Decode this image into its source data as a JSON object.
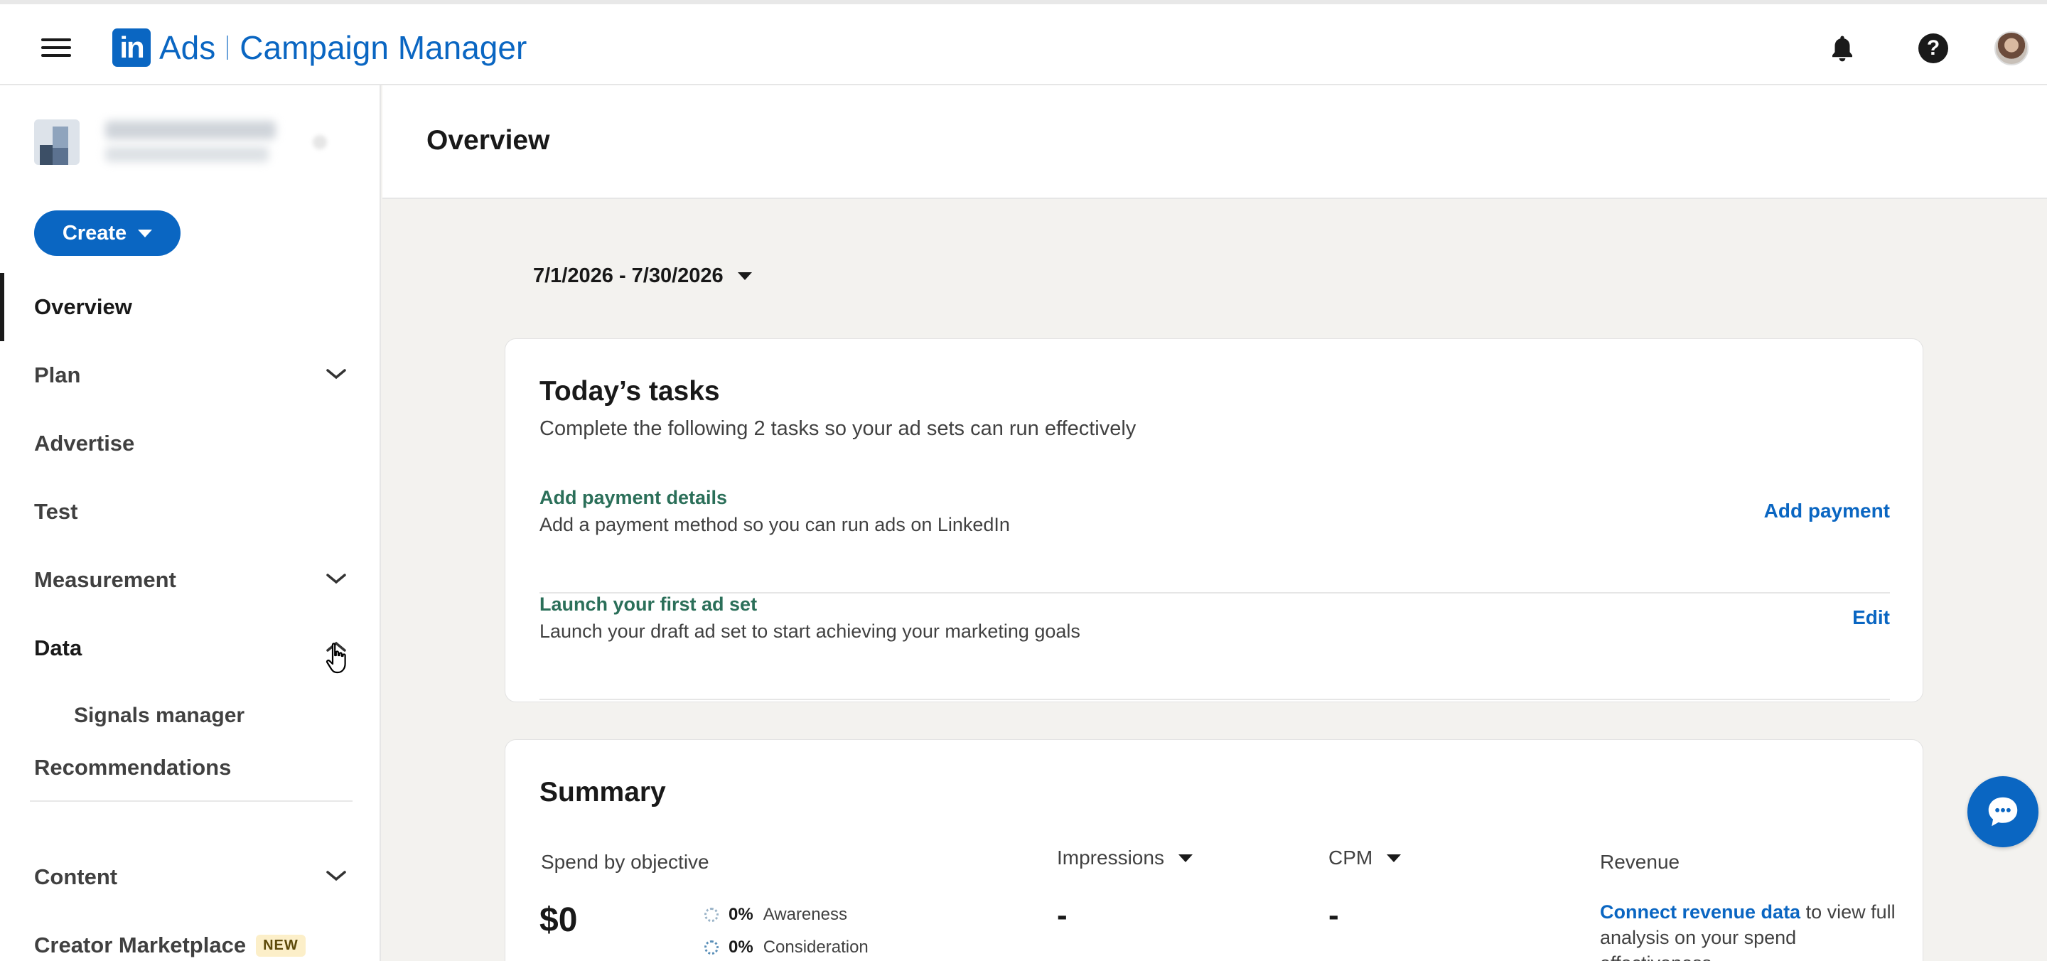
{
  "app": {
    "brand_mark": "in",
    "brand_product": "Ads",
    "brand_name": "Campaign Manager"
  },
  "sidebar": {
    "create_label": "Create",
    "items": [
      {
        "label": "Overview",
        "active": true
      },
      {
        "label": "Plan",
        "expandable": true
      },
      {
        "label": "Advertise"
      },
      {
        "label": "Test"
      },
      {
        "label": "Measurement",
        "expandable": true
      },
      {
        "label": "Data",
        "expanded": true
      },
      {
        "label": "Signals manager",
        "sub": true
      },
      {
        "label": "Recommendations"
      },
      {
        "label": "Content",
        "expandable": true
      },
      {
        "label": "Creator Marketplace",
        "badge": "NEW"
      }
    ]
  },
  "main": {
    "title": "Overview",
    "date_range": "7/1/2026 - 7/30/2026",
    "tasks": {
      "title": "Today’s tasks",
      "subtitle": "Complete the following 2 tasks so your ad sets can run effectively",
      "items": [
        {
          "title": "Add payment details",
          "desc": "Add a payment method so you can run ads on LinkedIn",
          "action": "Add payment"
        },
        {
          "title": "Launch your first ad set",
          "desc": "Launch your draft ad set to start achieving your marketing goals",
          "action": "Edit"
        }
      ]
    },
    "summary": {
      "title": "Summary",
      "spend_label": "Spend by objective",
      "spend_value": "$0",
      "objectives": [
        {
          "pct": "0%",
          "name": "Awareness"
        },
        {
          "pct": "0%",
          "name": "Consideration"
        }
      ],
      "impressions_label": "Impressions",
      "impressions_value": "-",
      "cpm_label": "CPM",
      "cpm_value": "-",
      "revenue_label": "Revenue",
      "revenue_link": "Connect revenue data",
      "revenue_text": " to view full analysis on your spend effectiveness"
    }
  },
  "colors": {
    "brand": "#0a66c2",
    "task_title": "#2b6f59",
    "background": "#f3f2ef"
  }
}
